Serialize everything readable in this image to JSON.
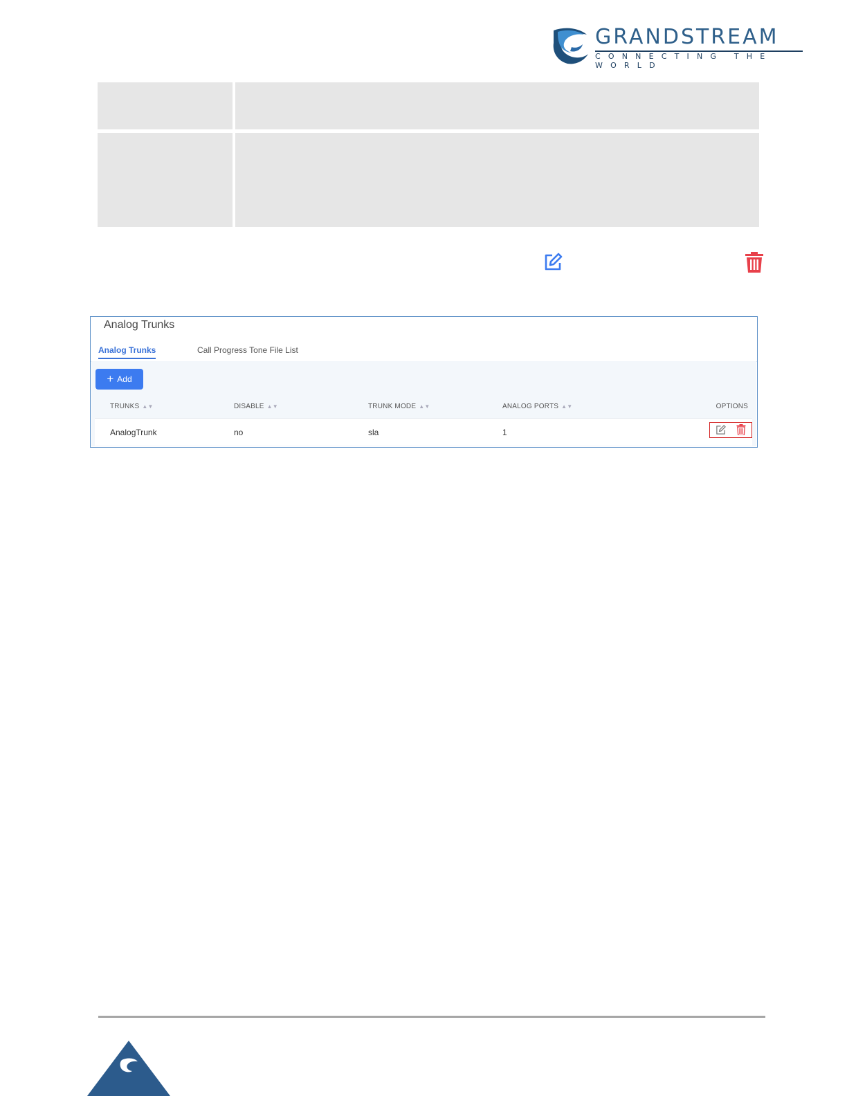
{
  "logo": {
    "wordmark": "GRANDSTREAM",
    "tagline": "CONNECTING THE WORLD"
  },
  "colors": {
    "brand_blue": "#2e5f8a",
    "edit_blue": "#3c7bf0",
    "delete_red": "#e8404a",
    "highlight_red": "#d32020",
    "gray_cell": "#e6e6e6"
  },
  "gray_table": {
    "rows": [
      {
        "cells": [
          "",
          ""
        ]
      },
      {
        "cells": [
          "",
          ""
        ]
      }
    ]
  },
  "icons": {
    "edit": "edit-icon",
    "delete": "trash-icon"
  },
  "panel": {
    "title": "Analog Trunks",
    "tabs": [
      {
        "label": "Analog Trunks",
        "active": true
      },
      {
        "label": "Call Progress Tone File List",
        "active": false
      }
    ],
    "add_label": "Add",
    "columns": [
      "TRUNKS",
      "DISABLE",
      "TRUNK MODE",
      "ANALOG PORTS",
      "OPTIONS"
    ],
    "rows": [
      {
        "trunks": "AnalogTrunk",
        "disable": "no",
        "trunk_mode": "sla",
        "analog_ports": "1"
      }
    ]
  }
}
